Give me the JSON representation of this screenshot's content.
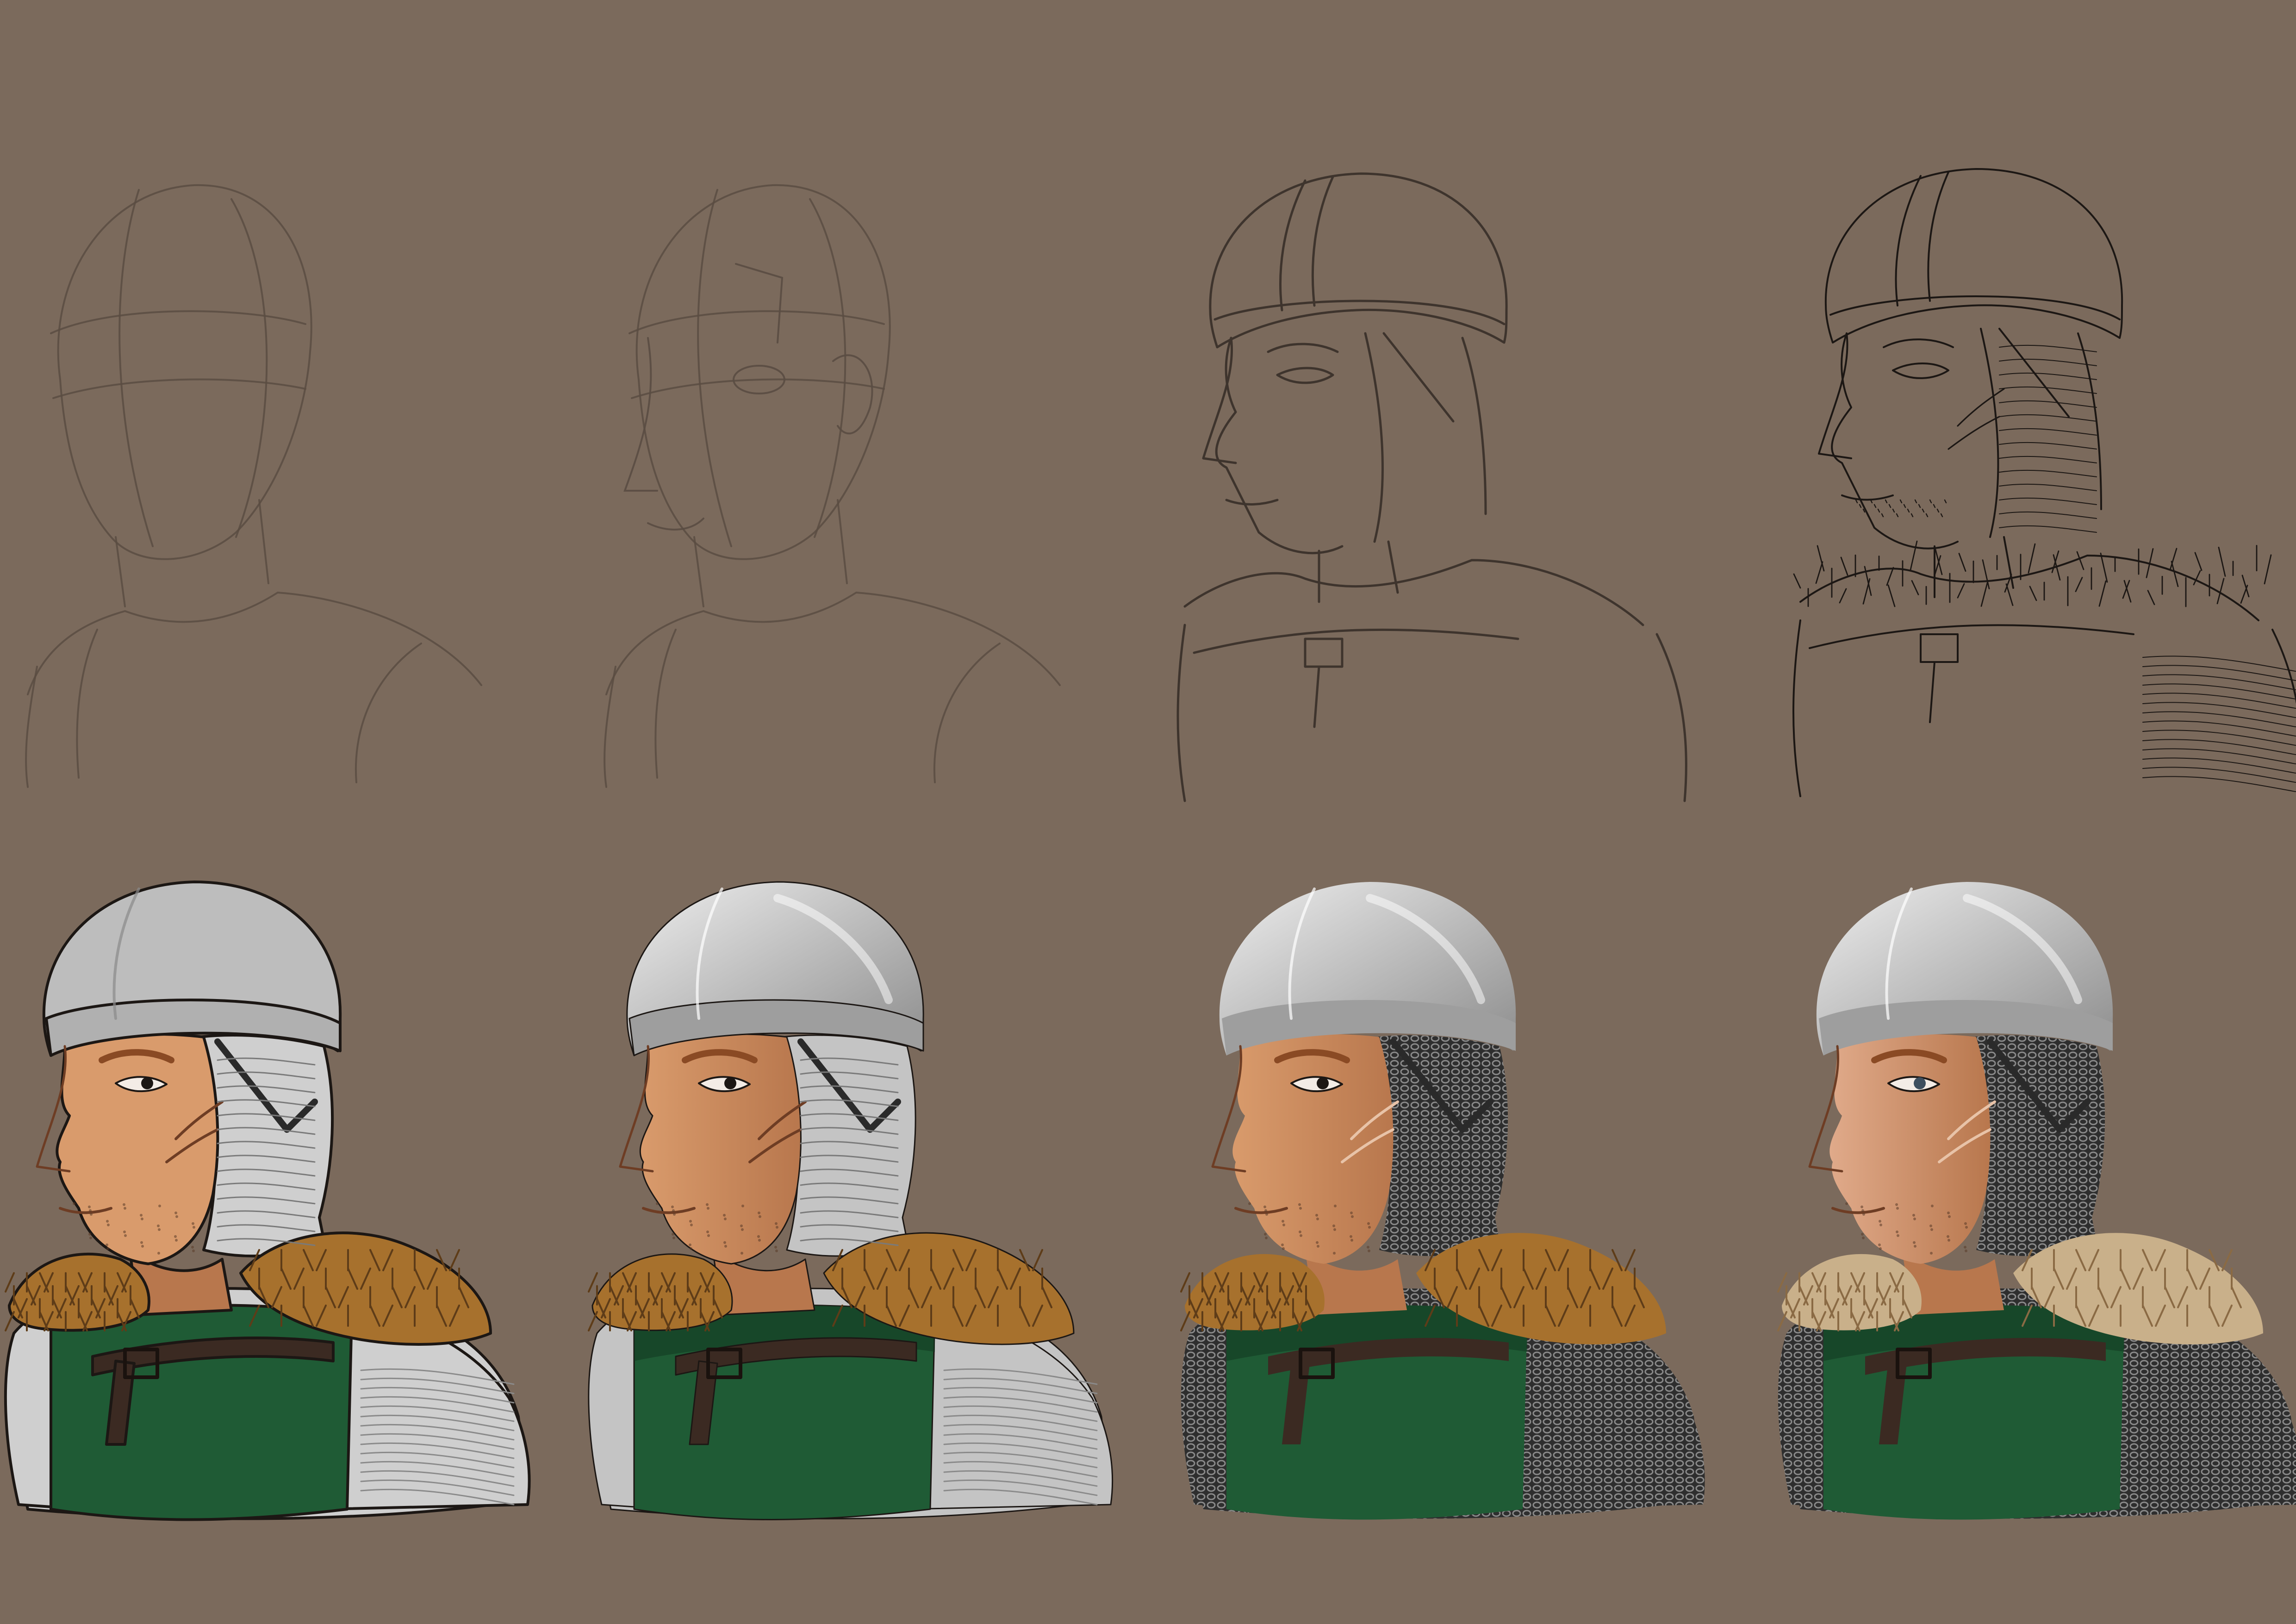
{
  "colors": {
    "background": "#7b6a5c",
    "sketch_light": "#5a4c42",
    "sketch_mid": "#3e342d",
    "lineart": "#1c1714",
    "skin_flat": "#d99b6c",
    "skin_shade": "#b8774d",
    "skin_final": "#c98a6a",
    "helmet_flat": "#bdbdbd",
    "helmet_shade": "#8c8c8c",
    "helmet_hi": "#eeeeee",
    "mail_flat": "#cfcfcf",
    "mail_dark": "#2e2e2e",
    "fur_flat": "#a7712d",
    "fur_dark": "#5e3c18",
    "fur_light": "#c9b08a",
    "tunic": "#1f5b35",
    "tunic_dark": "#123a22",
    "belt": "#3b2a22",
    "hair": "#8a4a24"
  },
  "stages": [
    {
      "id": "construction",
      "kind": "sketch",
      "level": 1
    },
    {
      "id": "features",
      "kind": "sketch",
      "level": 2
    },
    {
      "id": "rough-lines",
      "kind": "sketch",
      "level": 3
    },
    {
      "id": "clean-lines",
      "kind": "sketch",
      "level": 4
    },
    {
      "id": "flat-colors",
      "kind": "paint",
      "level": 1
    },
    {
      "id": "shading",
      "kind": "paint",
      "level": 2
    },
    {
      "id": "chainmail-texture",
      "kind": "paint",
      "level": 3
    },
    {
      "id": "final-render",
      "kind": "paint",
      "level": 4
    }
  ]
}
